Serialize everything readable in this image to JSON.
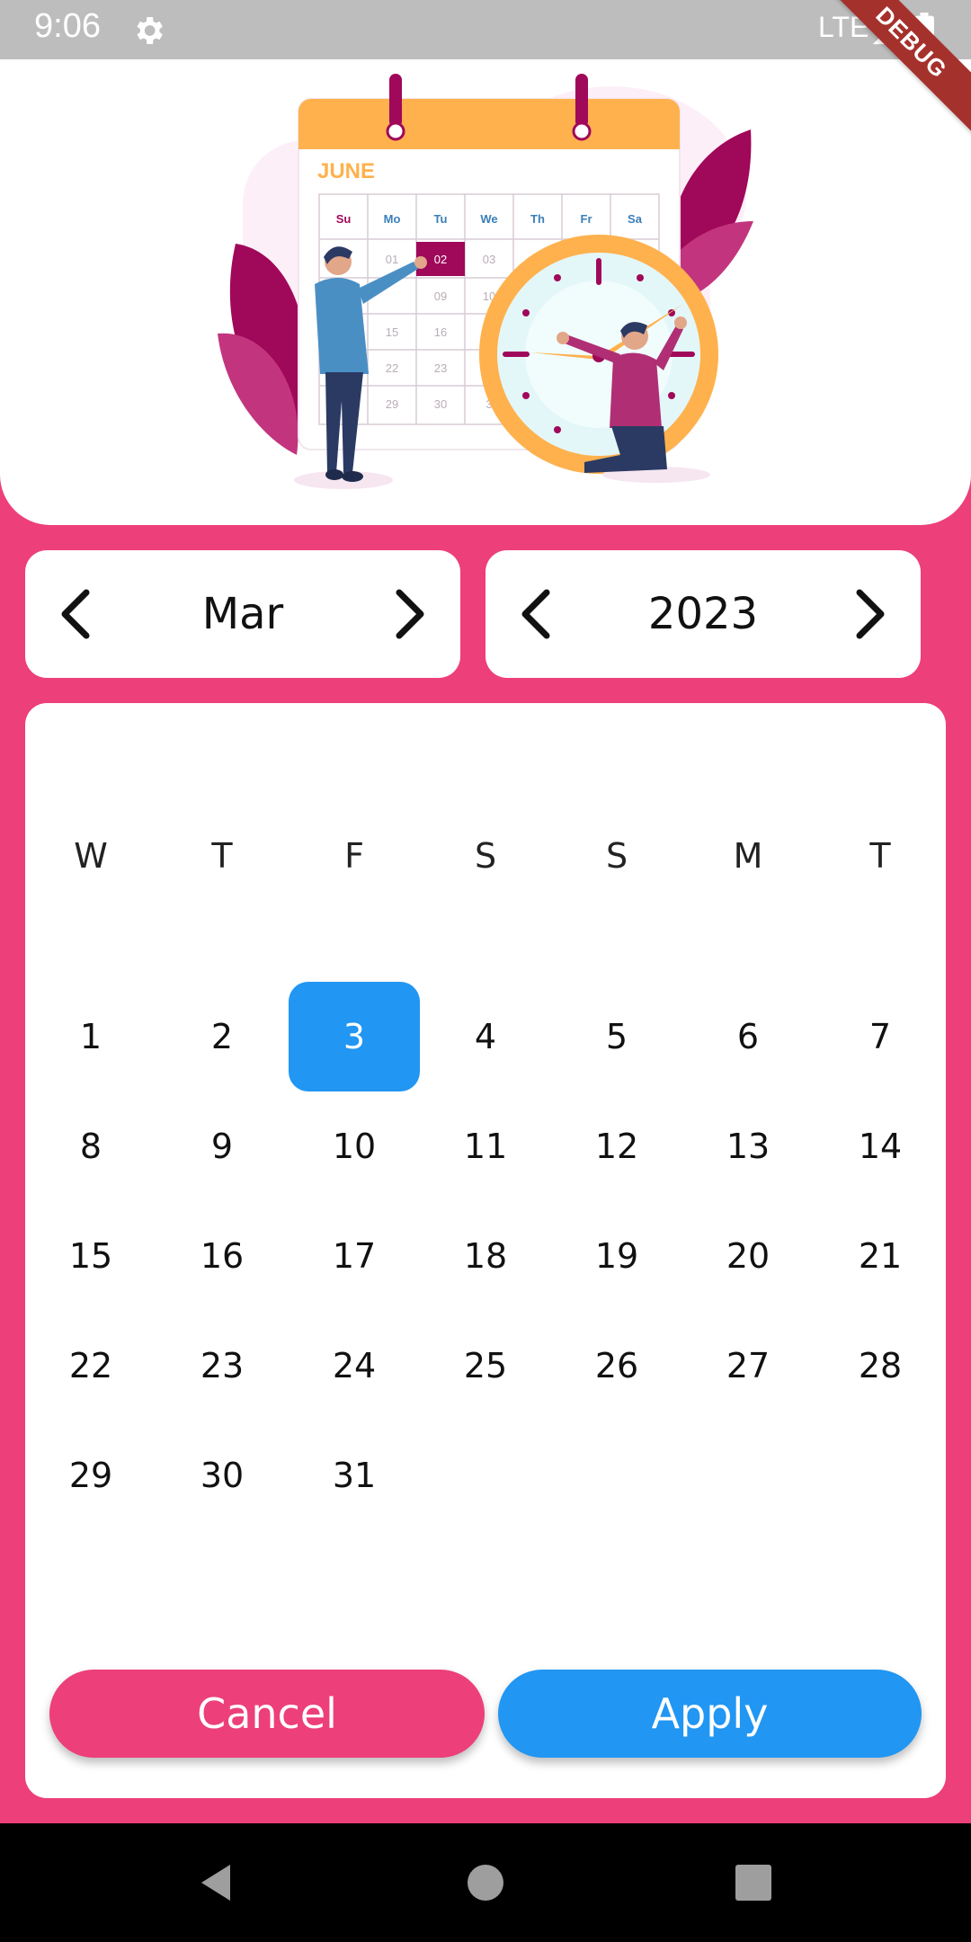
{
  "status_bar": {
    "time": "9:06",
    "network": "LTE",
    "icons": [
      "gear-icon",
      "signal-icon",
      "battery-icon"
    ]
  },
  "debug_banner": "DEBUG",
  "illustration": {
    "month_label": "JUNE",
    "day_headers": [
      "Su",
      "Mo",
      "Tu",
      "We",
      "Th",
      "Fr",
      "Sa"
    ],
    "dates": [
      "01",
      "02",
      "03",
      "09",
      "10",
      "15",
      "16",
      "22",
      "23",
      "29",
      "30",
      "3"
    ]
  },
  "month_selector": {
    "value": "Mar",
    "prev_icon": "chevron-left-icon",
    "next_icon": "chevron-right-icon"
  },
  "year_selector": {
    "value": "2023",
    "prev_icon": "chevron-left-icon",
    "next_icon": "chevron-right-icon"
  },
  "calendar": {
    "weekdays": [
      "W",
      "T",
      "F",
      "S",
      "S",
      "M",
      "T"
    ],
    "days": [
      "1",
      "2",
      "3",
      "4",
      "5",
      "6",
      "7",
      "8",
      "9",
      "10",
      "11",
      "12",
      "13",
      "14",
      "15",
      "16",
      "17",
      "18",
      "19",
      "20",
      "21",
      "22",
      "23",
      "24",
      "25",
      "26",
      "27",
      "28",
      "29",
      "30",
      "31"
    ],
    "selected_day": "3"
  },
  "actions": {
    "cancel": "Cancel",
    "apply": "Apply"
  },
  "colors": {
    "primary_pink": "#ED3F79",
    "accent_blue": "#2196F3",
    "orange": "#FFB14E",
    "magenta": "#A0085A"
  },
  "nav_bar": {
    "icons": [
      "back-icon",
      "home-icon",
      "recents-icon"
    ]
  }
}
